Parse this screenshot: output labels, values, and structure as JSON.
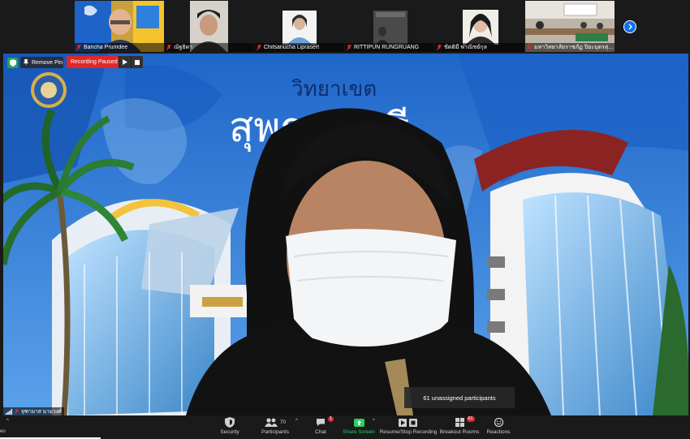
{
  "participants_strip": [
    {
      "name": "Bancha Prumdee"
    },
    {
      "name": "ณัฐธิดา"
    },
    {
      "name": "Chitsanucha Liprasert"
    },
    {
      "name": "RITTIPUN RUNGRUANG"
    },
    {
      "name": "ขัตติมี พาณิชย์กุล"
    },
    {
      "name": "มหาวิทยาลัยราชภัฏ ปิยะบุตรสุพ..."
    }
  ],
  "strip_next_icon": "chevron-right-icon",
  "main_video": {
    "background_text_line1": "วิทยาเขต",
    "background_text_line2": "สุพรรณบุรี",
    "speaker_name": "จุฑามาส นามวงศ์"
  },
  "overlay": {
    "remove_pin_label": "Remove Pin",
    "recording_status": "Recording Paused",
    "unassigned_text": "61 unassigned participants"
  },
  "toolbar": {
    "leftmost_label": "eo",
    "security_label": "Security",
    "participants_label": "Participants",
    "participants_count": "70",
    "chat_label": "Chat",
    "chat_badge": "1",
    "share_label": "Share Screen",
    "record_label": "Resume/Stop Recording",
    "breakout_label": "Breakout Rooms",
    "breakout_badge": "61",
    "reactions_label": "Reactions"
  },
  "colors": {
    "recording_red": "#e02828",
    "share_green": "#23d160",
    "zoom_blue": "#0e71eb",
    "secure_green": "#23a455"
  }
}
